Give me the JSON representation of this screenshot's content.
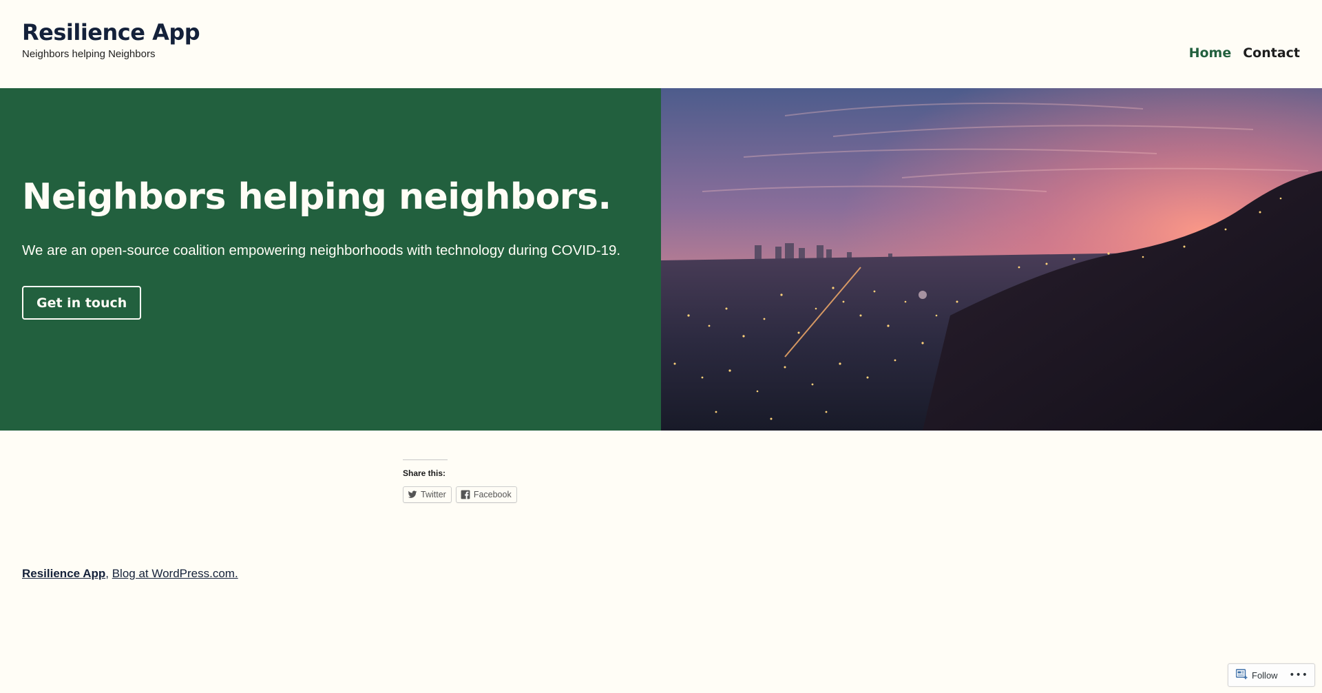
{
  "header": {
    "site_title": "Resilience App",
    "tagline": "Neighbors helping Neighbors",
    "nav": [
      {
        "label": "Home",
        "active": true
      },
      {
        "label": "Contact",
        "active": false
      }
    ]
  },
  "hero": {
    "title": "Neighbors helping neighbors.",
    "subtitle": "We are an open-source coalition empowering neighborhoods with technology during COVID-19.",
    "button_label": "Get in touch",
    "background_color": "#22603e",
    "image_icon": "city-sunset-image"
  },
  "sharing": {
    "title": "Share this:",
    "buttons": [
      {
        "label": "Twitter",
        "icon": "twitter-icon"
      },
      {
        "label": "Facebook",
        "icon": "facebook-icon"
      }
    ]
  },
  "footer": {
    "site_link": "Resilience App",
    "separator": ",",
    "blog_link": "Blog at WordPress.com."
  },
  "follow_widget": {
    "label": "Follow",
    "icon": "reader-follow-icon",
    "more": "•••"
  },
  "colors": {
    "background": "#fffdf6",
    "accent": "#22603e",
    "text": "#14213a"
  }
}
